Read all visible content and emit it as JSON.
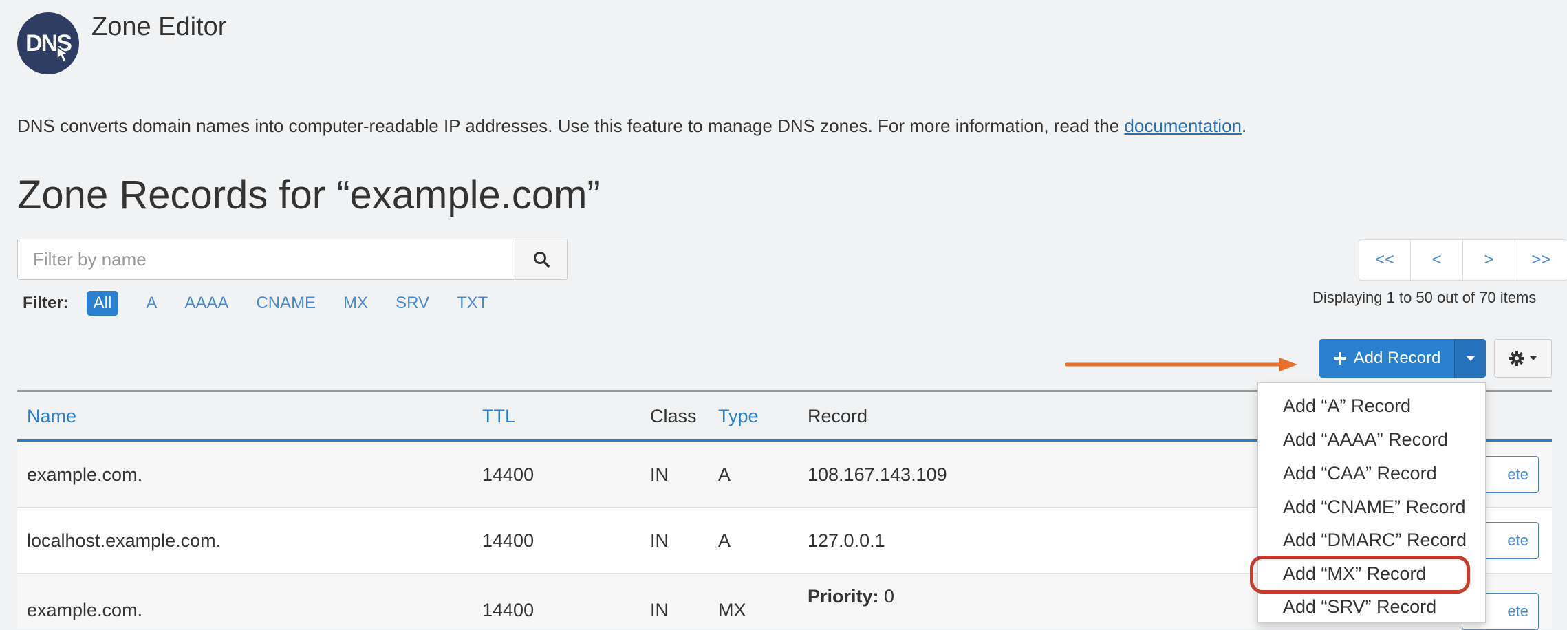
{
  "header": {
    "logo_text": "DNS",
    "app_title": "Zone Editor"
  },
  "intro": {
    "text": "DNS converts domain names into computer-readable IP addresses. Use this feature to manage DNS zones. For more information, read the ",
    "link": "documentation",
    "suffix": "."
  },
  "page_heading": "Zone Records for “example.com”",
  "search": {
    "placeholder": "Filter by name",
    "icon": "search-icon"
  },
  "filter": {
    "label": "Filter:",
    "chips": [
      "All",
      "A",
      "AAAA",
      "CNAME",
      "MX",
      "SRV",
      "TXT"
    ],
    "active": "All"
  },
  "pagination": {
    "buttons": [
      "<<",
      "<",
      ">",
      ">>"
    ],
    "status": "Displaying 1 to 50 out of 70 items"
  },
  "toolbar": {
    "add_record_label": "Add Record",
    "add_icon": "plus-icon",
    "toggle_icon": "caret-down-icon",
    "settings_icon": "gear-icon"
  },
  "table": {
    "columns": [
      "Name",
      "TTL",
      "Class",
      "Type",
      "Record"
    ],
    "rows": [
      {
        "name": "example.com.",
        "ttl": "14400",
        "class": "IN",
        "type": "A",
        "record": "108.167.143.109",
        "action": "ete"
      },
      {
        "name": "localhost.example.com.",
        "ttl": "14400",
        "class": "IN",
        "type": "A",
        "record": "127.0.0.1",
        "action": "ete"
      },
      {
        "name": "example.com.",
        "ttl": "14400",
        "class": "IN",
        "type": "MX",
        "record_label": "Priority:",
        "record_value": "0",
        "action": "ete"
      }
    ]
  },
  "add_menu": {
    "items": [
      "Add “A” Record",
      "Add “AAAA” Record",
      "Add “CAA” Record",
      "Add “CNAME” Record",
      "Add “DMARC” Record",
      "Add “MX” Record",
      "Add “SRV” Record"
    ],
    "highlighted": "Add “MX” Record"
  },
  "colors": {
    "primary": "#2a7fcf",
    "link": "#4a8ad0",
    "arrow": "#e8702a",
    "highlight": "#c63b2b",
    "background": "#f1f2f3"
  }
}
